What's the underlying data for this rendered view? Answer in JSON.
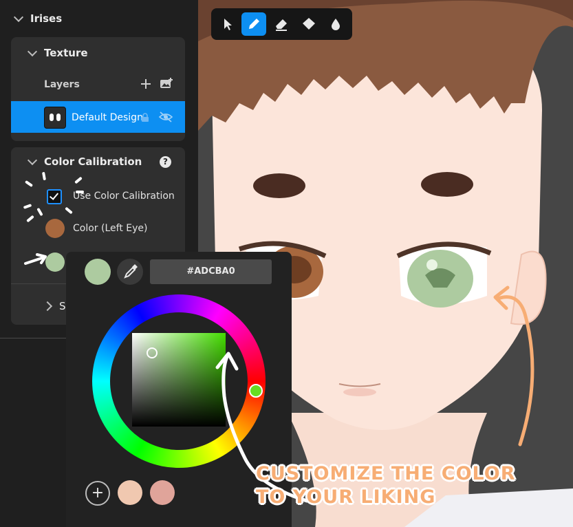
{
  "panel": {
    "irises_title": "Irises",
    "texture_title": "Texture",
    "layers_label": "Layers",
    "layer_name": "Default Design",
    "color_calibration_title": "Color Calibration",
    "use_calibration_label": "Use Color Calibration",
    "use_calibration_checked": true,
    "left_eye_label": "Color (Left Eye)",
    "left_eye_color": "#a8683e",
    "right_eye_color": "#adcba0",
    "collapsed_section_label": "S"
  },
  "toolbar": {
    "tools": [
      "select-tool",
      "pen-tool",
      "eraser-tool",
      "fill-tool",
      "blur-tool"
    ],
    "active": "pen-tool"
  },
  "picker": {
    "current_color": "#adcba0",
    "hex_value": "#ADCBA0",
    "recent_colors": [
      "#f0c8b0",
      "#e0a49a"
    ]
  },
  "annotation": {
    "line1": "CUSTOMIZE THE COLOR",
    "line2": "TO YOUR LIKING"
  },
  "colors": {
    "accent": "#0d8ff2",
    "annotation_orange": "#f7ad74"
  }
}
